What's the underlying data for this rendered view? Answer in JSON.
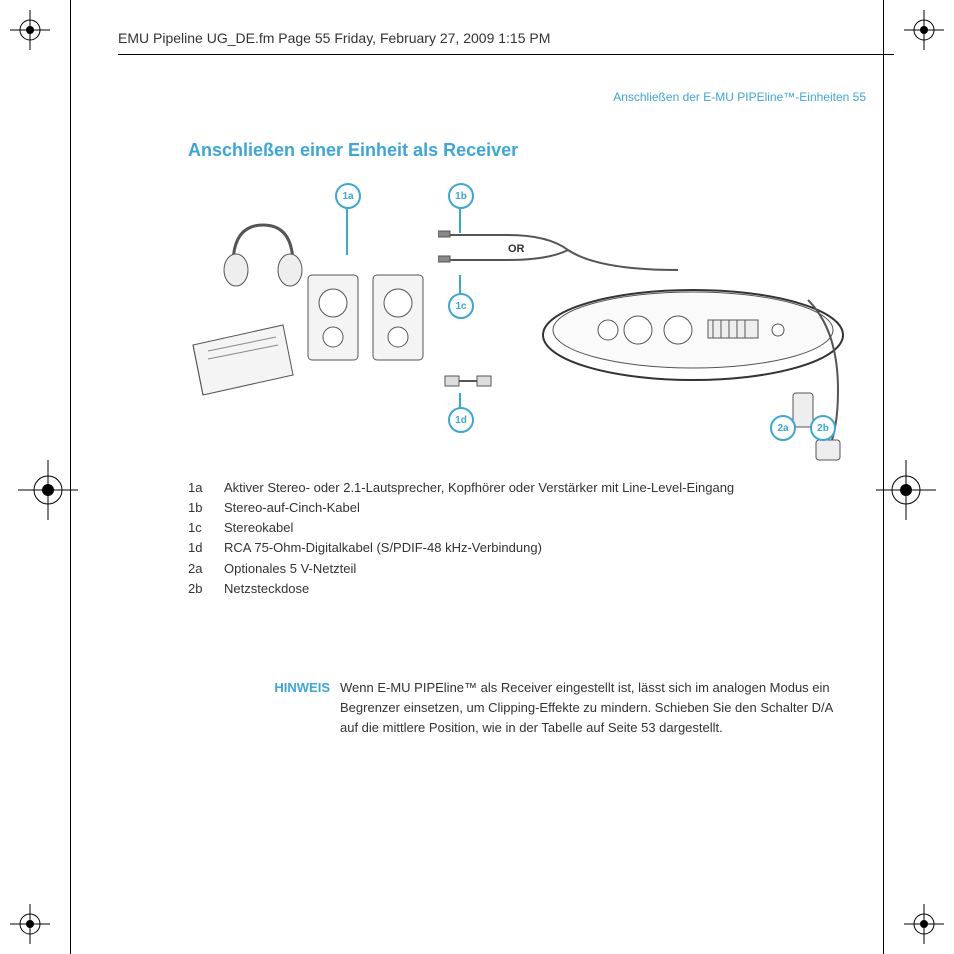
{
  "header_line": "EMU Pipeline UG_DE.fm  Page 55  Friday, February 27, 2009  1:15 PM",
  "running_head": "Anschließen der E-MU PIPEline™-Einheiten  55",
  "section_title": "Anschließen einer Einheit als Receiver",
  "diagram": {
    "callouts": {
      "c1a": "1a",
      "c1b": "1b",
      "c1c": "1c",
      "c1d": "1d",
      "c2a": "2a",
      "c2b": "2b"
    },
    "or_label": "OR"
  },
  "legend": [
    {
      "key": "1a",
      "text": "Aktiver Stereo- oder 2.1-Lautsprecher, Kopfhörer oder Verstärker mit Line-Level-Eingang"
    },
    {
      "key": "1b",
      "text": "Stereo-auf-Cinch-Kabel"
    },
    {
      "key": "1c",
      "text": "Stereokabel"
    },
    {
      "key": "1d",
      "text": "RCA 75-Ohm-Digitalkabel (S/PDIF-48 kHz-Verbindung)"
    },
    {
      "key": "2a",
      "text": "Optionales 5 V-Netzteil"
    },
    {
      "key": "2b",
      "text": "Netzsteckdose"
    }
  ],
  "note": {
    "label": "HINWEIS",
    "text": "Wenn E-MU PIPEline™ als Receiver eingestellt ist, lässt sich im analogen Modus ein Begrenzer einsetzen, um Clipping-Effekte zu mindern. Schieben Sie den Schalter D/A auf die mittlere Position, wie in der Tabelle auf Seite 53 dargestellt."
  }
}
